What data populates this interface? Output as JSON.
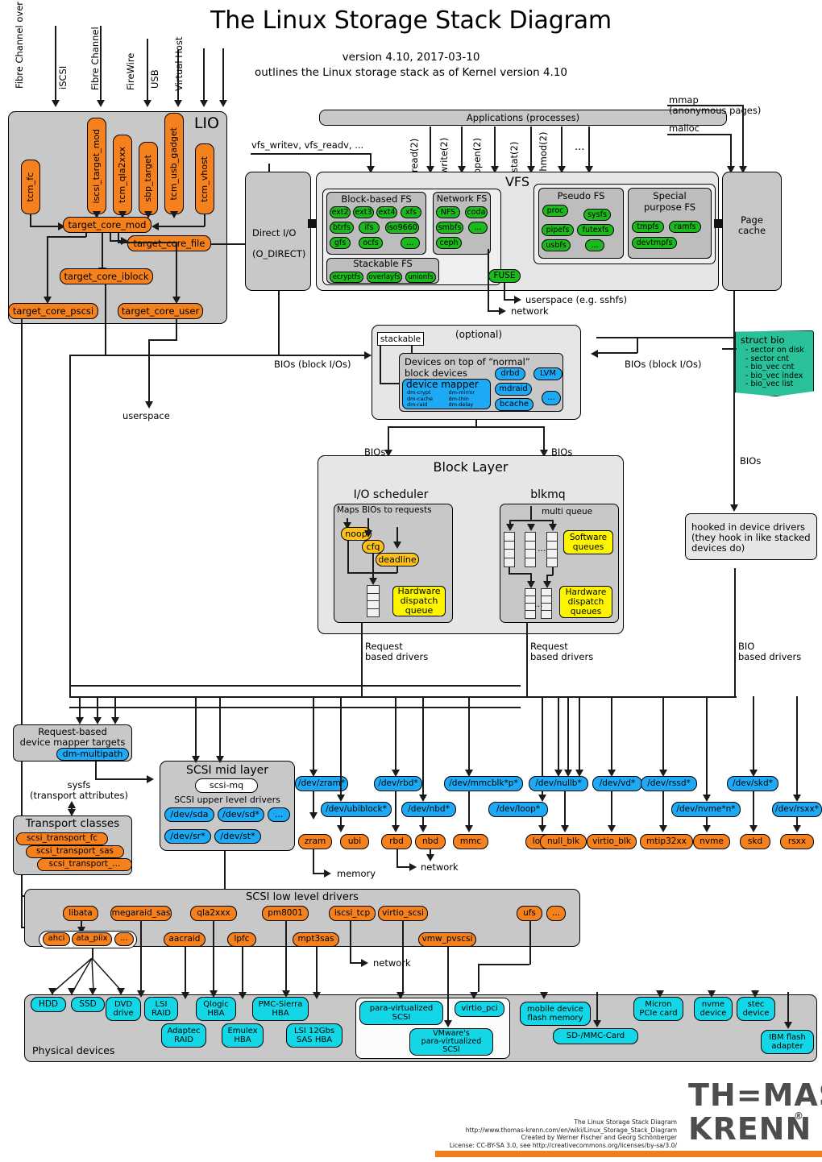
{
  "header": {
    "title": "The Linux Storage Stack Diagram",
    "version_line": "version 4.10, 2017-03-10",
    "desc_line": "outlines the Linux storage stack as of Kernel version 4.10"
  },
  "top_inputs": [
    {
      "label": "Fibre Channel\nover Ethernet"
    },
    {
      "label": "iSCSI"
    },
    {
      "label": "Fibre Channel"
    },
    {
      "label": "FireWire"
    },
    {
      "label": "USB"
    },
    {
      "label": "Virtual Host"
    }
  ],
  "lio": {
    "title": "LIO",
    "fabrics": [
      "tcm_fc",
      "iscsi_target_mod",
      "tcm_qla2xxx",
      "sbp_target",
      "tcm_usb_gadget",
      "tcm_vhost"
    ],
    "core": "target_core_mod",
    "backstores": [
      "target_core_file",
      "target_core_iblock",
      "target_core_pscsi",
      "target_core_user"
    ],
    "userspace_label": "userspace"
  },
  "applications": {
    "label": "Applications (processes)"
  },
  "syscalls": [
    "read(2)",
    "write(2)",
    "open(2)",
    "stat(2)",
    "chmod(2)",
    "..."
  ],
  "vfs_entry_label": "vfs_writev, vfs_readv, ...",
  "mmap_label": "mmap\n(anonymous pages)",
  "malloc_label": "malloc",
  "direct_io": {
    "line1": "Direct I/O",
    "line2": "(O_DIRECT)"
  },
  "vfs": {
    "title": "VFS",
    "block_fs": {
      "title": "Block-based FS",
      "items": [
        "ext2",
        "ext3",
        "ext4",
        "xfs",
        "btrfs",
        "ifs",
        "iso9660",
        "gfs",
        "ocfs",
        "..."
      ]
    },
    "network_fs": {
      "title": "Network FS",
      "items": [
        "NFS",
        "coda",
        "smbfs",
        "...",
        "ceph"
      ]
    },
    "pseudo_fs": {
      "title": "Pseudo FS",
      "items": [
        "proc",
        "sysfs",
        "pipefs",
        "futexfs",
        "usbfs",
        "..."
      ]
    },
    "special_fs": {
      "title": "Special\npurpose FS",
      "items": [
        "tmpfs",
        "ramfs",
        "devtmpfs"
      ]
    },
    "stackable_fs": {
      "title": "Stackable FS",
      "items": [
        "ecryptfs",
        "overlayfs",
        "unionfs"
      ]
    },
    "fuse": "FUSE",
    "userspace_note": "userspace (e.g. sshfs)",
    "network_note": "network"
  },
  "page_cache": {
    "label": "Page\ncache"
  },
  "optional_layer": {
    "optional_label": "(optional)",
    "stackable_label": "stackable",
    "devices_title": "Devices on top of “normal”\nblock devices",
    "device_mapper": {
      "title": "device mapper",
      "targets": [
        "dm-crypt",
        "dm-mirror",
        "dm-cache",
        "dm-thin",
        "dm-raid",
        "dm-delay"
      ]
    },
    "others": [
      "drbd",
      "LVM",
      "mdraid",
      "bcache",
      "..."
    ],
    "bios_left_label": "BIOs (block I/Os)",
    "bios_right_label": "BIOs (block I/Os)"
  },
  "struct_bio": {
    "title": "struct bio",
    "fields": [
      "- sector on disk",
      "- sector cnt",
      "- bio_vec cnt",
      "- bio_vec index",
      "- bio_vec list"
    ]
  },
  "block_layer": {
    "title": "Block Layer",
    "bios_label_left": "BIOs",
    "bios_label_right": "BIOs",
    "bios_label_far_right": "BIOs",
    "io_scheduler": {
      "title": "I/O scheduler",
      "maps_label": "Maps BIOs to requests",
      "schedulers": [
        "noop",
        "cfq",
        "deadline"
      ],
      "hw_dispatch_queue": "Hardware\ndispatch\nqueue"
    },
    "blkmq": {
      "title": "blkmq",
      "multi_queue_label": "multi queue",
      "software_queues": "Software\nqueues",
      "hw_dispatch_queues": "Hardware\ndispatch\nqueues",
      "ellipsis": "..."
    },
    "request_based_left": "Request\nbased drivers",
    "request_based_right": "Request\nbased drivers",
    "bio_based": "BIO\nbased drivers"
  },
  "hooked_in": {
    "label": "hooked in device drivers\n(they hook in like stacked\ndevices do)"
  },
  "request_based_dm": {
    "title": "Request-based\ndevice mapper targets",
    "item": "dm-multipath"
  },
  "sysfs_label": "sysfs\n(transport attributes)",
  "transport_classes": {
    "title": "Transport classes",
    "items": [
      "scsi_transport_fc",
      "scsi_transport_sas",
      "scsi_transport_..."
    ]
  },
  "scsi_mid_layer": {
    "title": "SCSI mid layer",
    "scsi_mq": "scsi-mq",
    "upper_label": "SCSI upper level drivers",
    "devices": [
      "/dev/sda",
      "/dev/sd*",
      "...",
      "/dev/sr*",
      "/dev/st*"
    ]
  },
  "device_nodes_top": [
    "/dev/zram*",
    "/dev/rbd*",
    "/dev/mmcblk*p*",
    "/dev/nullb*",
    "/dev/vd*",
    "/dev/rssd*",
    "/dev/skd*"
  ],
  "device_nodes_bottom": [
    "/dev/ubiblock*",
    "/dev/nbd*",
    "/dev/loop*",
    "/dev/nvme*n*",
    "/dev/rsxx*"
  ],
  "block_drivers": [
    "zram",
    "ubi",
    "rbd",
    "nbd",
    "mmc",
    "loop",
    "null_blk",
    "virtio_blk",
    "mtip32xx",
    "nvme",
    "skd",
    "rsxx"
  ],
  "memory_label": "memory",
  "network_label_1": "network",
  "network_label_2": "network",
  "scsi_low_level": {
    "title": "SCSI low level drivers",
    "row1": [
      "libata",
      "megaraid_sas",
      "qla2xxx",
      "pm8001",
      "iscsi_tcp",
      "virtio_scsi",
      "ufs",
      "..."
    ],
    "libata_group": [
      "ahci",
      "ata_piix",
      "..."
    ],
    "row2": [
      "aacraid",
      "lpfc",
      "mpt3sas",
      "vmw_pvscsi"
    ]
  },
  "physical_devices": {
    "title": "Physical devices",
    "row1": [
      "HDD",
      "SSD",
      "DVD\ndrive",
      "LSI\nRAID",
      "Qlogic\nHBA",
      "PMC-Sierra\nHBA"
    ],
    "row2": [
      "Adaptec\nRAID",
      "Emulex\nHBA",
      "LSI 12Gbs\nSAS HBA"
    ],
    "virt_group": [
      "para-virtualized\nSCSI",
      "virtio_pci",
      "VMware's\npara-virtualized\nSCSI"
    ],
    "right": [
      "mobile device\nflash memory",
      "SD-/MMC-Card",
      "Micron\nPCIe card",
      "nvme\ndevice",
      "stec\ndevice",
      "IBM flash\nadapter"
    ]
  },
  "footer": {
    "logo_top": "TH=MAS",
    "logo_bottom": "KRENN",
    "registered": "®",
    "lines": [
      "The Linux Storage Stack Diagram",
      "http://www.thomas-krenn.com/en/wiki/Linux_Storage_Stack_Diagram",
      "Created by Werner Fischer and Georg Schönberger",
      "License: CC-BY-SA 3.0, see http://creativecommons.org/licenses/by-sa/3.0/"
    ]
  },
  "colors": {
    "orange": "#f4801e",
    "green": "#1db81d",
    "blue": "#1ea9f5",
    "cyan": "#13d7e6",
    "yellow": "#fdf500",
    "amber": "#fcc21b",
    "teal": "#29c09a",
    "panel": "#c8c8c8",
    "brand": "#ee7f1c"
  }
}
